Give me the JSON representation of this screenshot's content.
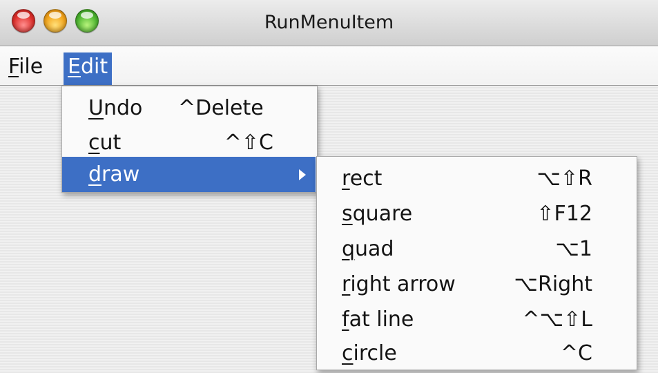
{
  "window": {
    "title": "RunMenuItem"
  },
  "menubar": {
    "items": [
      {
        "mnemonic": "F",
        "rest": "ile"
      },
      {
        "mnemonic": "E",
        "rest": "dit"
      }
    ]
  },
  "edit_menu": {
    "items": [
      {
        "mnemonic": "U",
        "rest": "ndo",
        "shortcut": "^Delete"
      },
      {
        "mnemonic": "c",
        "rest": "ut",
        "shortcut": "^⇧C"
      },
      {
        "mnemonic": "d",
        "rest": "raw",
        "shortcut": "",
        "has_submenu": true,
        "selected": true
      }
    ]
  },
  "draw_menu": {
    "items": [
      {
        "mnemonic": "r",
        "rest": "ect",
        "shortcut": "⌥⇧R"
      },
      {
        "mnemonic": "s",
        "rest": "quare",
        "shortcut": "⇧F12"
      },
      {
        "mnemonic": "q",
        "rest": "uad",
        "shortcut": "⌥1"
      },
      {
        "mnemonic": "r",
        "rest": "ight arrow",
        "shortcut": "⌥Right"
      },
      {
        "mnemonic": "f",
        "rest": "at line",
        "shortcut": "^⌥⇧L"
      },
      {
        "mnemonic": "c",
        "rest": "ircle",
        "shortcut": "^C"
      }
    ]
  },
  "colors": {
    "selection": "#3d6fc5",
    "menu_background": "#fafafa"
  }
}
